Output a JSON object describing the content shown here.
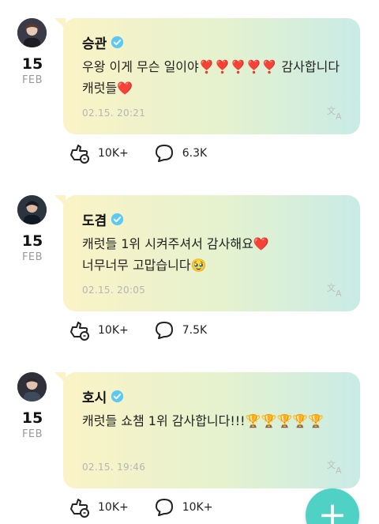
{
  "colors": {
    "bubble_start": "#fbf3c6",
    "bubble_end": "#c9ebe6",
    "verified": "#5bc8f5",
    "fab": "#4fd1c5"
  },
  "posts": [
    {
      "author": "승관",
      "day": "15",
      "month": "FEB",
      "text": "우왕 이게 무슨 일이야❣️❣️❣️❣️❣️ 감사합니다 캐럿들❤️",
      "time": "02.15. 20:21",
      "likes": "10K+",
      "comments": "6.3K",
      "avatar_icon": "avatar-person"
    },
    {
      "author": "도겸",
      "day": "15",
      "month": "FEB",
      "text": "캐럿들 1위 시켜주셔서 감사해요❤️\n너무너무 고맙습니다🥹",
      "time": "02.15. 20:05",
      "likes": "10K+",
      "comments": "7.5K",
      "avatar_icon": "avatar-person"
    },
    {
      "author": "호시",
      "day": "15",
      "month": "FEB",
      "text": "캐럿들 쇼챔 1위 감사합니다!!!🏆🏆🏆🏆🏆",
      "time": "02.15. 19:46",
      "likes": "10K+",
      "comments": "10K+",
      "avatar_icon": "avatar-person"
    }
  ],
  "fab": {
    "icon": "plus-icon",
    "label": "+"
  }
}
